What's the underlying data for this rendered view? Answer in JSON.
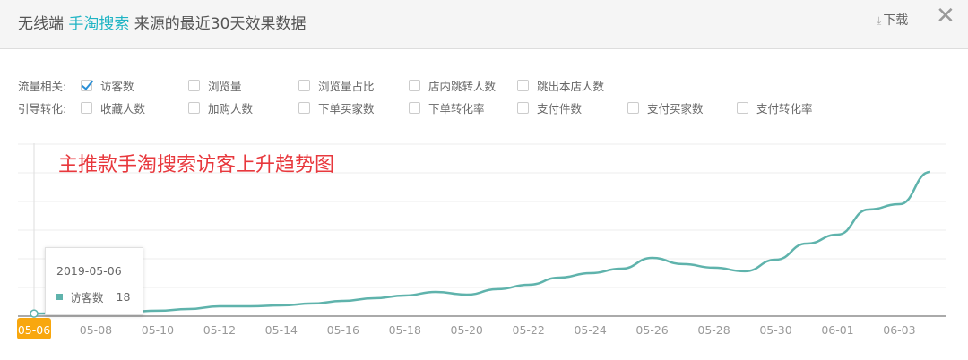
{
  "header": {
    "title_prefix": "无线端 ",
    "title_highlight": "手淘搜索",
    "title_suffix": " 来源的最近30天效果数据",
    "download_label": "下载",
    "download_icon": "download-icon",
    "close_icon": "close-icon"
  },
  "filters": {
    "rows": [
      {
        "label": "流量相关:",
        "options": [
          {
            "label": "访客数",
            "checked": true
          },
          {
            "label": "浏览量",
            "checked": false
          },
          {
            "label": "浏览量占比",
            "checked": false
          },
          {
            "label": "店内跳转人数",
            "checked": false
          },
          {
            "label": "跳出本店人数",
            "checked": false
          }
        ]
      },
      {
        "label": "引导转化:",
        "options": [
          {
            "label": "收藏人数",
            "checked": false
          },
          {
            "label": "加购人数",
            "checked": false
          },
          {
            "label": "下单买家数",
            "checked": false
          },
          {
            "label": "下单转化率",
            "checked": false
          },
          {
            "label": "支付件数",
            "checked": false
          },
          {
            "label": "支付买家数",
            "checked": false
          },
          {
            "label": "支付转化率",
            "checked": false
          }
        ]
      }
    ]
  },
  "annotation": "主推款手淘搜索访客上升趋势图",
  "tooltip": {
    "date": "2019-05-06",
    "series": "访客数",
    "value": "18"
  },
  "chart_data": {
    "type": "line",
    "title": "",
    "series": [
      {
        "name": "访客数",
        "color": "#5fb3ac",
        "values": [
          18,
          19,
          25,
          31,
          38,
          50,
          69,
          69,
          75,
          88,
          106,
          125,
          144,
          169,
          150,
          188,
          219,
          269,
          300,
          331,
          406,
          363,
          338,
          313,
          394,
          506,
          569,
          744,
          781,
          1006
        ]
      }
    ],
    "x": [
      "05-06",
      "05-07",
      "05-08",
      "05-09",
      "05-10",
      "05-11",
      "05-12",
      "05-13",
      "05-14",
      "05-15",
      "05-16",
      "05-17",
      "05-18",
      "05-19",
      "05-20",
      "05-21",
      "05-22",
      "05-23",
      "05-24",
      "05-25",
      "05-26",
      "05-27",
      "05-28",
      "05-29",
      "05-30",
      "05-31",
      "06-01",
      "06-02",
      "06-03",
      "06-04"
    ],
    "xtick_labels": [
      "05-06",
      "05-08",
      "05-10",
      "05-12",
      "05-14",
      "05-16",
      "05-18",
      "05-20",
      "05-22",
      "05-24",
      "05-26",
      "05-28",
      "05-30",
      "06-01",
      "06-03"
    ],
    "highlighted_x": "05-06",
    "ylim": [
      0,
      1200
    ],
    "grid": true,
    "ylabel": "",
    "xlabel": ""
  }
}
